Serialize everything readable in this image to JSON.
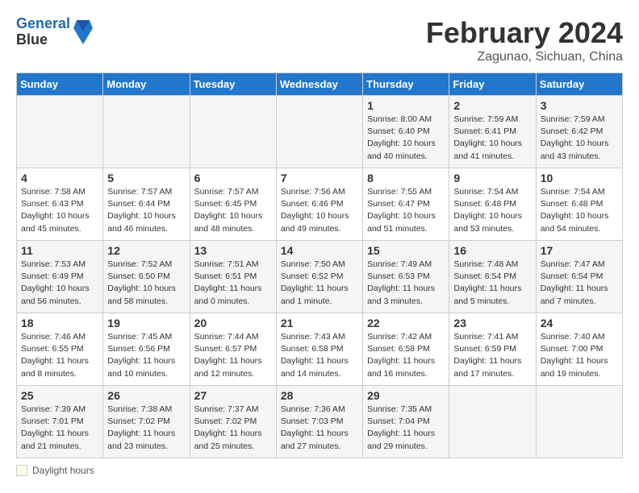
{
  "header": {
    "logo_line1": "General",
    "logo_line2": "Blue",
    "month": "February 2024",
    "location": "Zagunao, Sichuan, China"
  },
  "days_of_week": [
    "Sunday",
    "Monday",
    "Tuesday",
    "Wednesday",
    "Thursday",
    "Friday",
    "Saturday"
  ],
  "weeks": [
    [
      {
        "day": "",
        "info": ""
      },
      {
        "day": "",
        "info": ""
      },
      {
        "day": "",
        "info": ""
      },
      {
        "day": "",
        "info": ""
      },
      {
        "day": "1",
        "info": "Sunrise: 8:00 AM\nSunset: 6:40 PM\nDaylight: 10 hours\nand 40 minutes."
      },
      {
        "day": "2",
        "info": "Sunrise: 7:59 AM\nSunset: 6:41 PM\nDaylight: 10 hours\nand 41 minutes."
      },
      {
        "day": "3",
        "info": "Sunrise: 7:59 AM\nSunset: 6:42 PM\nDaylight: 10 hours\nand 43 minutes."
      }
    ],
    [
      {
        "day": "4",
        "info": "Sunrise: 7:58 AM\nSunset: 6:43 PM\nDaylight: 10 hours\nand 45 minutes."
      },
      {
        "day": "5",
        "info": "Sunrise: 7:57 AM\nSunset: 6:44 PM\nDaylight: 10 hours\nand 46 minutes."
      },
      {
        "day": "6",
        "info": "Sunrise: 7:57 AM\nSunset: 6:45 PM\nDaylight: 10 hours\nand 48 minutes."
      },
      {
        "day": "7",
        "info": "Sunrise: 7:56 AM\nSunset: 6:46 PM\nDaylight: 10 hours\nand 49 minutes."
      },
      {
        "day": "8",
        "info": "Sunrise: 7:55 AM\nSunset: 6:47 PM\nDaylight: 10 hours\nand 51 minutes."
      },
      {
        "day": "9",
        "info": "Sunrise: 7:54 AM\nSunset: 6:48 PM\nDaylight: 10 hours\nand 53 minutes."
      },
      {
        "day": "10",
        "info": "Sunrise: 7:54 AM\nSunset: 6:48 PM\nDaylight: 10 hours\nand 54 minutes."
      }
    ],
    [
      {
        "day": "11",
        "info": "Sunrise: 7:53 AM\nSunset: 6:49 PM\nDaylight: 10 hours\nand 56 minutes."
      },
      {
        "day": "12",
        "info": "Sunrise: 7:52 AM\nSunset: 6:50 PM\nDaylight: 10 hours\nand 58 minutes."
      },
      {
        "day": "13",
        "info": "Sunrise: 7:51 AM\nSunset: 6:51 PM\nDaylight: 11 hours\nand 0 minutes."
      },
      {
        "day": "14",
        "info": "Sunrise: 7:50 AM\nSunset: 6:52 PM\nDaylight: 11 hours\nand 1 minute."
      },
      {
        "day": "15",
        "info": "Sunrise: 7:49 AM\nSunset: 6:53 PM\nDaylight: 11 hours\nand 3 minutes."
      },
      {
        "day": "16",
        "info": "Sunrise: 7:48 AM\nSunset: 6:54 PM\nDaylight: 11 hours\nand 5 minutes."
      },
      {
        "day": "17",
        "info": "Sunrise: 7:47 AM\nSunset: 6:54 PM\nDaylight: 11 hours\nand 7 minutes."
      }
    ],
    [
      {
        "day": "18",
        "info": "Sunrise: 7:46 AM\nSunset: 6:55 PM\nDaylight: 11 hours\nand 8 minutes."
      },
      {
        "day": "19",
        "info": "Sunrise: 7:45 AM\nSunset: 6:56 PM\nDaylight: 11 hours\nand 10 minutes."
      },
      {
        "day": "20",
        "info": "Sunrise: 7:44 AM\nSunset: 6:57 PM\nDaylight: 11 hours\nand 12 minutes."
      },
      {
        "day": "21",
        "info": "Sunrise: 7:43 AM\nSunset: 6:58 PM\nDaylight: 11 hours\nand 14 minutes."
      },
      {
        "day": "22",
        "info": "Sunrise: 7:42 AM\nSunset: 6:58 PM\nDaylight: 11 hours\nand 16 minutes."
      },
      {
        "day": "23",
        "info": "Sunrise: 7:41 AM\nSunset: 6:59 PM\nDaylight: 11 hours\nand 17 minutes."
      },
      {
        "day": "24",
        "info": "Sunrise: 7:40 AM\nSunset: 7:00 PM\nDaylight: 11 hours\nand 19 minutes."
      }
    ],
    [
      {
        "day": "25",
        "info": "Sunrise: 7:39 AM\nSunset: 7:01 PM\nDaylight: 11 hours\nand 21 minutes."
      },
      {
        "day": "26",
        "info": "Sunrise: 7:38 AM\nSunset: 7:02 PM\nDaylight: 11 hours\nand 23 minutes."
      },
      {
        "day": "27",
        "info": "Sunrise: 7:37 AM\nSunset: 7:02 PM\nDaylight: 11 hours\nand 25 minutes."
      },
      {
        "day": "28",
        "info": "Sunrise: 7:36 AM\nSunset: 7:03 PM\nDaylight: 11 hours\nand 27 minutes."
      },
      {
        "day": "29",
        "info": "Sunrise: 7:35 AM\nSunset: 7:04 PM\nDaylight: 11 hours\nand 29 minutes."
      },
      {
        "day": "",
        "info": ""
      },
      {
        "day": "",
        "info": ""
      }
    ]
  ],
  "legend": {
    "box_label": "Daylight hours"
  }
}
